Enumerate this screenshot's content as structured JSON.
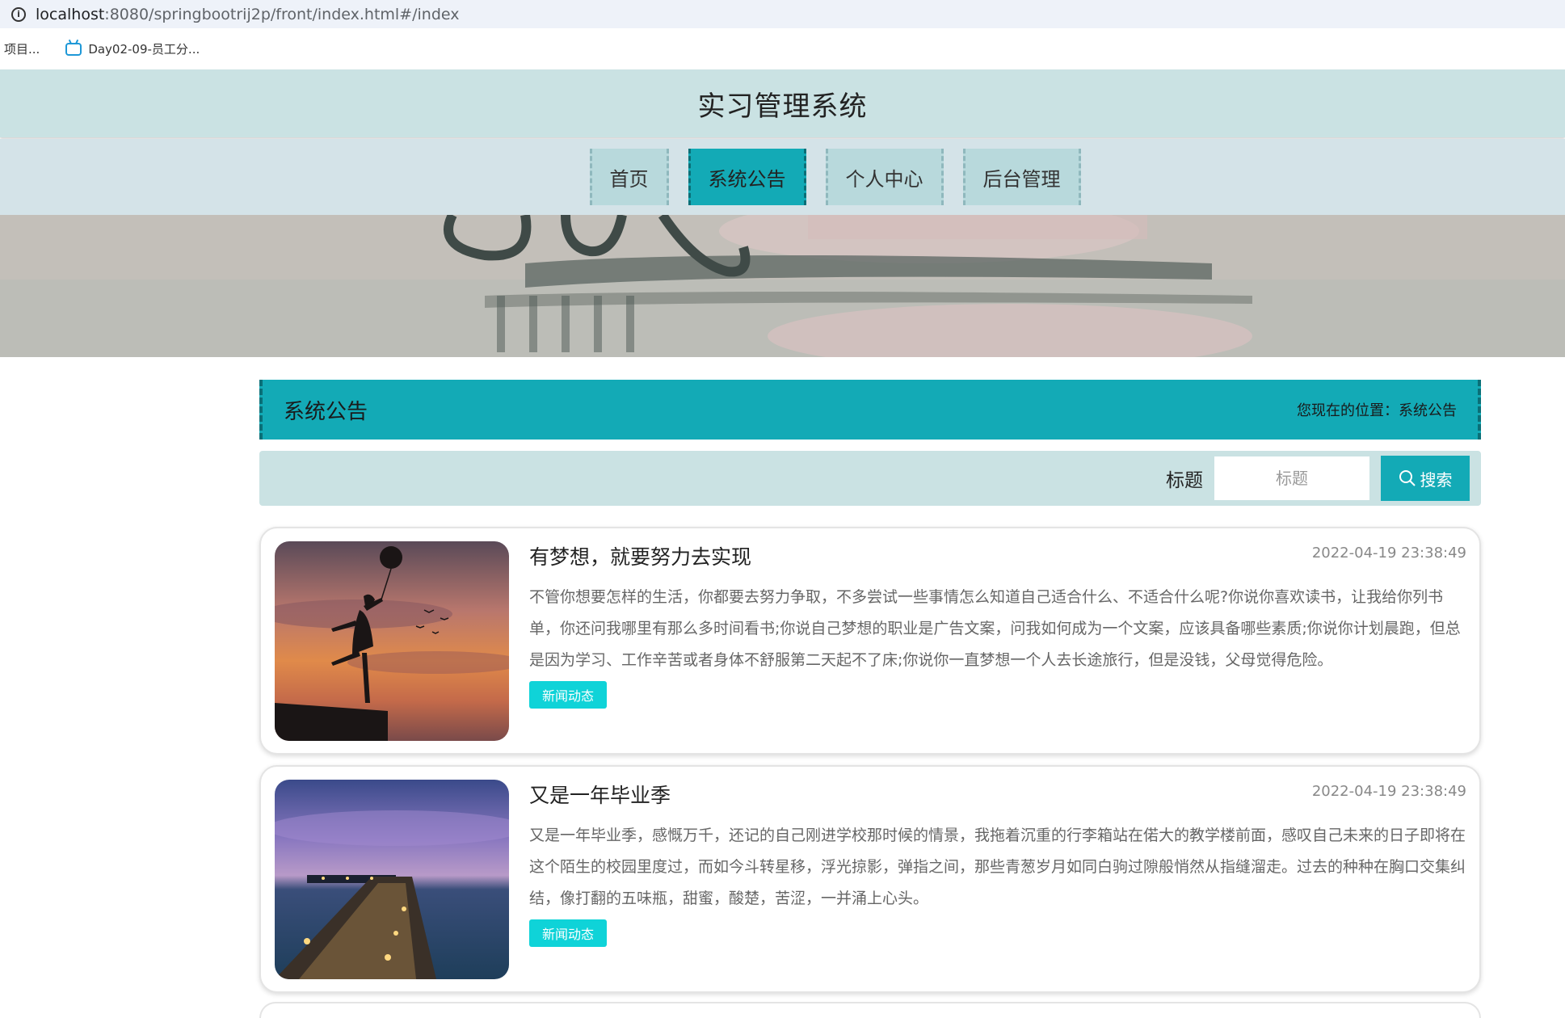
{
  "browser": {
    "url_host": "localhost",
    "url_path": ":8080/springbootrij2p/front/index.html#/index",
    "bookmarks": [
      {
        "label": "项目..."
      },
      {
        "label": "Day02-09-员工分..."
      }
    ]
  },
  "header": {
    "title": "实习管理系统"
  },
  "nav": {
    "items": [
      {
        "label": "首页",
        "active": false
      },
      {
        "label": "系统公告",
        "active": true
      },
      {
        "label": "个人中心",
        "active": false
      },
      {
        "label": "后台管理",
        "active": false
      }
    ]
  },
  "section": {
    "title": "系统公告",
    "breadcrumb_prefix": "您现在的位置：",
    "breadcrumb_current": "系统公告"
  },
  "search": {
    "label": "标题",
    "placeholder": "标题",
    "button_label": "搜索"
  },
  "notices": [
    {
      "title": "有梦想，就要努力去实现",
      "date": "2022-04-19 23:38:49",
      "body": "不管你想要怎样的生活，你都要去努力争取，不多尝试一些事情怎么知道自己适合什么、不适合什么呢?你说你喜欢读书，让我给你列书单，你还问我哪里有那么多时间看书;你说自己梦想的职业是广告文案，问我如何成为一个文案，应该具备哪些素质;你说你计划晨跑，但总是因为学习、工作辛苦或者身体不舒服第二天起不了床;你说你一直梦想一个人去长途旅行，但是没钱，父母觉得危险。",
      "tag": "新闻动态",
      "image": "girl-with-balloon-sunset"
    },
    {
      "title": "又是一年毕业季",
      "date": "2022-04-19 23:38:49",
      "body": "又是一年毕业季，感慨万千，还记的自己刚进学校那时候的情景，我拖着沉重的行李箱站在偌大的教学楼前面，感叹自己未来的日子即将在这个陌生的校园里度过，而如今斗转星移，浮光掠影，弹指之间，那些青葱岁月如同白驹过隙般悄然从指缝溜走。过去的种种在胸口交集纠结，像打翻的五味瓶，甜蜜，酸楚，苦涩，一并涌上心头。",
      "tag": "新闻动态",
      "image": "pier-at-dusk"
    }
  ],
  "colors": {
    "accent": "#13aab6",
    "header_bg": "#cae2e3",
    "nav_bg": "#d4e3e8",
    "tag_bg": "#0fd3d8"
  }
}
